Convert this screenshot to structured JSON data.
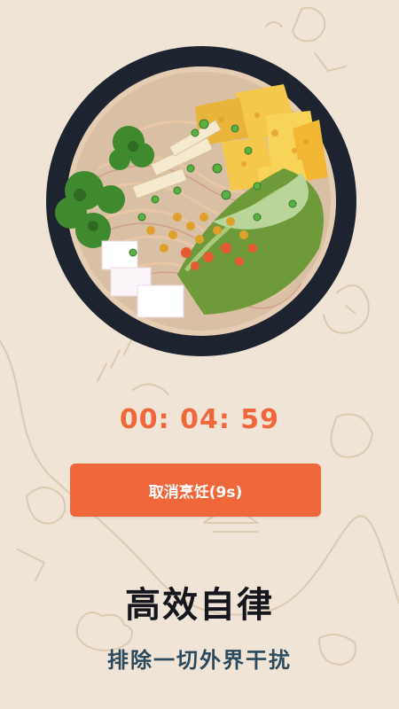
{
  "timer": {
    "text": "00: 04: 59"
  },
  "cancel_button": {
    "label": "取消烹饪(9s)"
  },
  "headline": {
    "title": "高效自律",
    "subtitle": "排除一切外界干扰"
  },
  "colors": {
    "background": "#efe4d6",
    "accent": "#f0673c",
    "title": "#16161e",
    "subtitle": "#2b4a5e",
    "bowl_rim": "#1d2430"
  },
  "icons": [
    "bowl-of-noodles-illustration",
    "doodle-background"
  ]
}
